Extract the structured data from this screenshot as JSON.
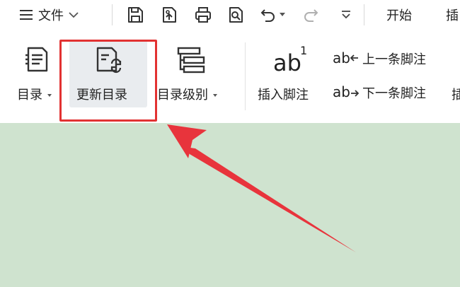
{
  "menubar": {
    "menu_icon": "hamburger-menu-icon",
    "file_label": "文件",
    "file_chevron": "chevron-down-icon",
    "quick_access": [
      "save-icon",
      "export-pdf-icon",
      "print-icon",
      "print-preview-icon",
      "undo-icon",
      "redo-icon",
      "customize-quick-access-icon"
    ],
    "start_tab": "开始",
    "next_tab_partial": "插"
  },
  "ribbon": {
    "toc": {
      "label": "目录",
      "icon": "table-of-contents-icon"
    },
    "update_toc": {
      "label": "更新目录",
      "icon": "update-toc-icon",
      "highlighted": true
    },
    "toc_level": {
      "label": "目录级别",
      "icon": "toc-level-icon"
    },
    "insert_footnote": {
      "label": "插入脚注",
      "glyph_main": "ab",
      "glyph_super": "1"
    },
    "prev_footnote": {
      "label": "上一条脚注",
      "glyph": "ab"
    },
    "next_footnote": {
      "label": "下一条脚注",
      "glyph": "ab"
    },
    "partial_right": "插"
  },
  "colors": {
    "annotation_red": "#e23232",
    "document_background": "#cfe3cf",
    "highlight_background": "#e9ecef"
  }
}
